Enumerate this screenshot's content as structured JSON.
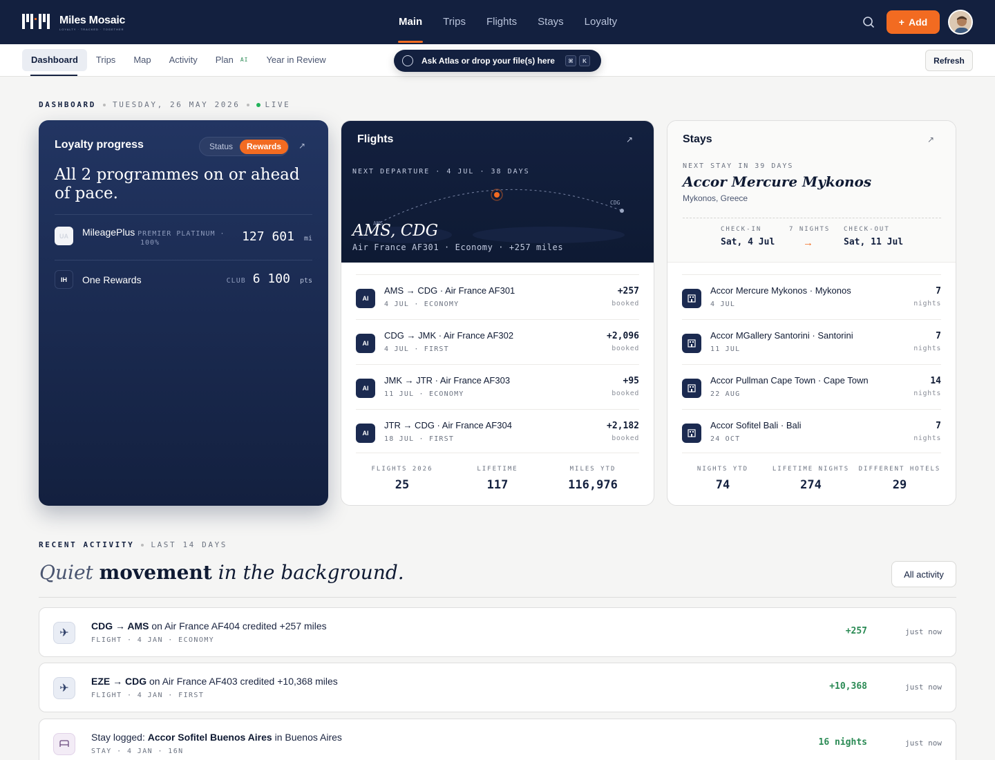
{
  "app": {
    "name": "Miles Mosaic",
    "tagline": "LOYALTY · TRACKED · TOGETHER",
    "brand_accent": "#f26b21",
    "brand_navy": "#13203f"
  },
  "mainnav": [
    {
      "label": "Main",
      "active": true
    },
    {
      "label": "Trips"
    },
    {
      "label": "Flights"
    },
    {
      "label": "Stays"
    },
    {
      "label": "Loyalty"
    }
  ],
  "header": {
    "add_label": "Add",
    "search_icon": "search-icon",
    "avatar_icon": "user-avatar"
  },
  "subnav": [
    {
      "label": "Dashboard",
      "active": true
    },
    {
      "label": "Trips"
    },
    {
      "label": "Map"
    },
    {
      "label": "Activity"
    },
    {
      "label": "Plan",
      "badge": "AI"
    },
    {
      "label": "Year in Review"
    }
  ],
  "ask": {
    "label": "Ask Atlas or drop your file(s) here",
    "key1": "⌘",
    "key2": "K"
  },
  "refresh_label": "Refresh",
  "breadcrumb": {
    "section": "DASHBOARD",
    "date": "TUESDAY, 26 MAY 2026",
    "live": "LIVE"
  },
  "loyalty": {
    "title": "Loyalty progress",
    "toggle": [
      "Status",
      "Rewards"
    ],
    "headline": "All 2 programmes on or ahead of pace.",
    "programs": [
      {
        "badge": "UA",
        "name": "MileagePlus",
        "tier": "PREMIER PLATINUM ·",
        "pct": "100%",
        "value": "127 601",
        "unit": "mi"
      },
      {
        "badge": "IH",
        "name": "One Rewards",
        "tier": "CLUB",
        "value": "6 100",
        "unit": "pts"
      }
    ]
  },
  "flights": {
    "title": "Flights",
    "next": "NEXT DEPARTURE · 4 JUL · 38 DAYS",
    "from": "AMS",
    "to": "CDG",
    "route": "AMS, CDG",
    "meta": "Air France AF301 · Economy · +257 miles",
    "rows": [
      {
        "badge": "AI",
        "title": "AMS → CDG · Air France AF301",
        "sub": "4 JUL · ECONOMY",
        "value": "+257",
        "value_sub": "booked"
      },
      {
        "badge": "AI",
        "title": "CDG → JMK · Air France AF302",
        "sub": "4 JUL · FIRST",
        "value": "+2,096",
        "value_sub": "booked"
      },
      {
        "badge": "AI",
        "title": "JMK → JTR · Air France AF303",
        "sub": "11 JUL · ECONOMY",
        "value": "+95",
        "value_sub": "booked"
      },
      {
        "badge": "AI",
        "title": "JTR → CDG · Air France AF304",
        "sub": "18 JUL · FIRST",
        "value": "+2,182",
        "value_sub": "booked"
      }
    ],
    "stats": [
      {
        "label": "FLIGHTS 2026",
        "value": "25"
      },
      {
        "label": "LIFETIME",
        "value": "117"
      },
      {
        "label": "MILES YTD",
        "value": "116,976"
      }
    ]
  },
  "stays": {
    "title": "Stays",
    "next": "NEXT STAY IN 39 DAYS",
    "name": "Accor Mercure Mykonos",
    "location": "Mykonos, Greece",
    "checkin_label": "CHECK-IN",
    "checkin": "Sat, 4 Jul",
    "nights": "7 NIGHTS",
    "checkout_label": "CHECK-OUT",
    "checkout": "Sat, 11 Jul",
    "rows": [
      {
        "title": "Accor Mercure Mykonos · Mykonos",
        "sub": "4 JUL",
        "value": "7",
        "value_sub": "nights"
      },
      {
        "title": "Accor MGallery Santorini · Santorini",
        "sub": "11 JUL",
        "value": "7",
        "value_sub": "nights"
      },
      {
        "title": "Accor Pullman Cape Town · Cape Town",
        "sub": "22 AUG",
        "value": "14",
        "value_sub": "nights"
      },
      {
        "title": "Accor Sofitel Bali · Bali",
        "sub": "24 OCT",
        "value": "7",
        "value_sub": "nights"
      }
    ],
    "stats": [
      {
        "label": "NIGHTS YTD",
        "value": "74"
      },
      {
        "label": "LIFETIME NIGHTS",
        "value": "274"
      },
      {
        "label": "DIFFERENT HOTELS",
        "value": "29"
      }
    ]
  },
  "recent": {
    "section": "RECENT ACTIVITY",
    "range": "LAST 14 DAYS",
    "head_italic1": "Quiet",
    "head_bold": "movement",
    "head_italic2": "in the background.",
    "all_label": "All activity",
    "items": [
      {
        "type": "flight",
        "strong": "CDG → AMS",
        "rest": " on Air France AF404 credited +257 miles",
        "sub": "FLIGHT · 4 JAN · ECONOMY",
        "value": "+257",
        "time": "just now"
      },
      {
        "type": "flight",
        "strong": "EZE → CDG",
        "rest": " on Air France AF403 credited +10,368 miles",
        "sub": "FLIGHT · 4 JAN · FIRST",
        "value": "+10,368",
        "time": "just now"
      },
      {
        "type": "stay",
        "prefix": "Stay logged: ",
        "strong": "Accor Sofitel Buenos Aires",
        "rest": " in Buenos Aires",
        "sub": "STAY · 4 JAN · 16N",
        "value": "16 nights",
        "time": "just now"
      }
    ]
  }
}
